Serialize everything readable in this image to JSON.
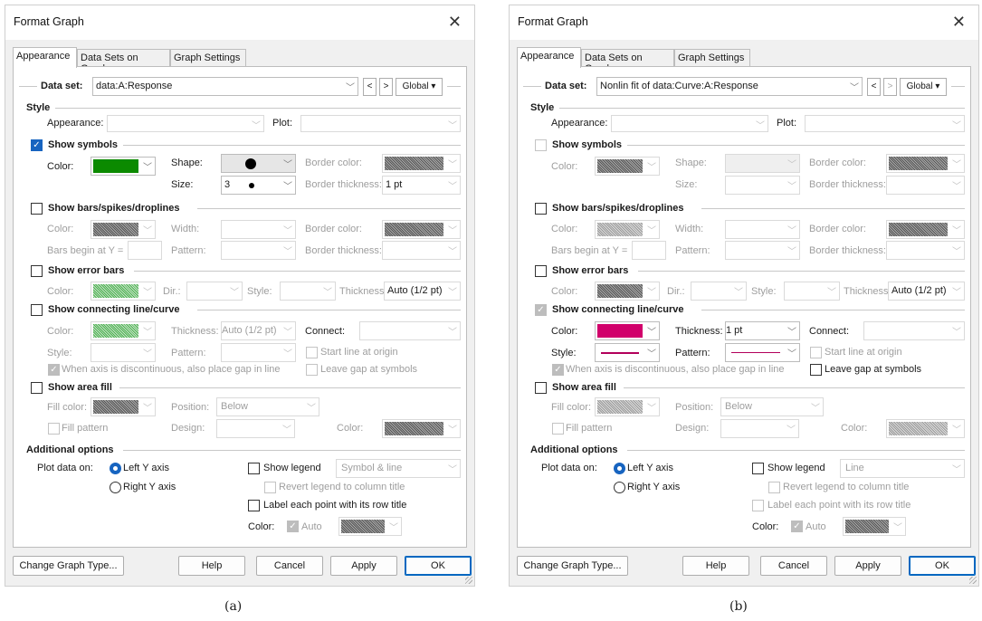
{
  "captions": [
    "(a)",
    "(b)"
  ],
  "dialogs": [
    {
      "title": "Format Graph",
      "tabs": [
        "Appearance",
        "Data Sets on Graph",
        "Graph Settings"
      ],
      "data_set_label": "Data set:",
      "data_set_value": "data:A:Response",
      "global_label": "Global",
      "style_header": "Style",
      "appearance_label": "Appearance:",
      "plot_label": "Plot:",
      "symbols": {
        "header": "Show symbols",
        "checked": true,
        "color_label": "Color:",
        "color": "#0b8a00",
        "shape_label": "Shape:",
        "size_label": "Size:",
        "size_value": "3",
        "border_color_label": "Border color:",
        "border_thickness_label": "Border thickness:",
        "border_thickness_value": "1 pt"
      },
      "bars": {
        "header": "Show bars/spikes/droplines",
        "color_label": "Color:",
        "width_label": "Width:",
        "border_color_label": "Border color:",
        "begin_label": "Bars begin at Y =",
        "pattern_label": "Pattern:",
        "border_thickness_label": "Border thickness:"
      },
      "errors": {
        "header": "Show error bars",
        "color_label": "Color:",
        "dir_label": "Dir.:",
        "style_label": "Style:",
        "thickness_label": "Thickness",
        "thickness_value": "Auto (1/2 pt)"
      },
      "connecting": {
        "header": "Show connecting line/curve",
        "color_label": "Color:",
        "thickness_label": "Thickness:",
        "thickness_value": "Auto (1/2 pt)",
        "connect_label": "Connect:",
        "style_label": "Style:",
        "pattern_label": "Pattern:",
        "start_origin": "Start line at origin",
        "gap_axis": "When axis is discontinuous, also place gap in line",
        "leave_gap": "Leave gap at symbols"
      },
      "area": {
        "header": "Show area fill",
        "fill_color_label": "Fill color:",
        "position_label": "Position:",
        "position_value": "Below",
        "fill_pattern": "Fill pattern",
        "design_label": "Design:",
        "color_label": "Color:"
      },
      "additional": {
        "header": "Additional options",
        "plot_on_label": "Plot data on:",
        "left_axis": "Left Y axis",
        "right_axis": "Right  Y axis",
        "show_legend": "Show legend",
        "legend_value": "Symbol & line",
        "revert_legend": "Revert legend to column title",
        "label_points": "Label each point with its row title",
        "color_label": "Color:",
        "auto_label": "Auto"
      },
      "buttons": {
        "change": "Change Graph Type...",
        "help": "Help",
        "cancel": "Cancel",
        "apply": "Apply",
        "ok": "OK"
      }
    },
    {
      "title": "Format Graph",
      "tabs": [
        "Appearance",
        "Data Sets on Graph",
        "Graph Settings"
      ],
      "data_set_label": "Data set:",
      "data_set_value": "Nonlin fit of data:Curve:A:Response",
      "global_label": "Global",
      "style_header": "Style",
      "appearance_label": "Appearance:",
      "plot_label": "Plot:",
      "symbols": {
        "header": "Show symbols",
        "checked": false,
        "color_label": "Color:",
        "shape_label": "Shape:",
        "size_label": "Size:",
        "border_color_label": "Border color:",
        "border_thickness_label": "Border thickness:"
      },
      "bars": {
        "header": "Show bars/spikes/droplines",
        "color_label": "Color:",
        "width_label": "Width:",
        "border_color_label": "Border color:",
        "begin_label": "Bars begin at Y =",
        "pattern_label": "Pattern:",
        "border_thickness_label": "Border thickness:"
      },
      "errors": {
        "header": "Show error bars",
        "color_label": "Color:",
        "dir_label": "Dir.:",
        "style_label": "Style:",
        "thickness_label": "Thickness",
        "thickness_value": "Auto (1/2 pt)"
      },
      "connecting": {
        "header": "Show connecting line/curve",
        "color_label": "Color:",
        "color": "#d1006b",
        "thickness_label": "Thickness:",
        "thickness_value": "1 pt",
        "connect_label": "Connect:",
        "style_label": "Style:",
        "pattern_label": "Pattern:",
        "start_origin": "Start line at origin",
        "gap_axis": "When axis is discontinuous, also place gap in line",
        "leave_gap": "Leave gap at symbols"
      },
      "area": {
        "header": "Show area fill",
        "fill_color_label": "Fill color:",
        "position_label": "Position:",
        "position_value": "Below",
        "fill_pattern": "Fill pattern",
        "design_label": "Design:",
        "color_label": "Color:"
      },
      "additional": {
        "header": "Additional options",
        "plot_on_label": "Plot data on:",
        "left_axis": "Left Y axis",
        "right_axis": "Right  Y axis",
        "show_legend": "Show legend",
        "legend_value": "Line",
        "revert_legend": "Revert legend to column title",
        "label_points": "Label each point with its row title",
        "color_label": "Color:",
        "auto_label": "Auto"
      },
      "buttons": {
        "change": "Change Graph Type...",
        "help": "Help",
        "cancel": "Cancel",
        "apply": "Apply",
        "ok": "OK"
      }
    }
  ]
}
